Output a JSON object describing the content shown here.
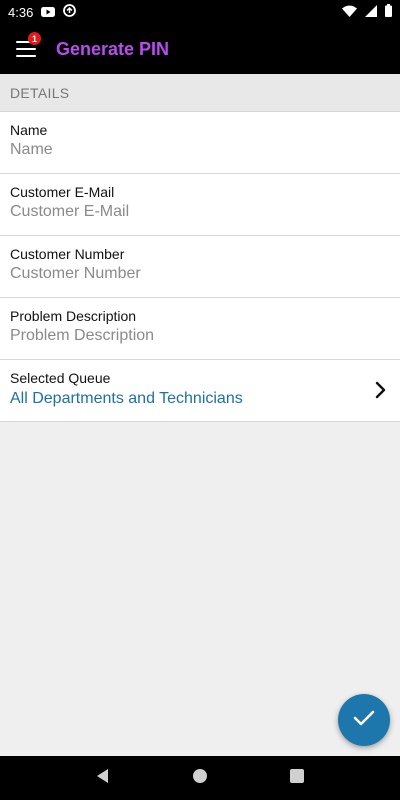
{
  "status_bar": {
    "time": "4:36",
    "icons": [
      "youtube-icon",
      "sync-icon",
      "wifi-icon",
      "signal-icon",
      "battery-icon"
    ]
  },
  "app_bar": {
    "title": "Generate PIN",
    "badge_count": "1",
    "title_color": "#b84cf0"
  },
  "section": {
    "header": "DETAILS"
  },
  "form": {
    "name": {
      "label": "Name",
      "placeholder": "Name"
    },
    "email": {
      "label": "Customer E-Mail",
      "placeholder": "Customer E-Mail"
    },
    "customer_number": {
      "label": "Customer Number",
      "placeholder": "Customer Number"
    },
    "problem": {
      "label": "Problem Description",
      "placeholder": "Problem Description"
    },
    "queue": {
      "label": "Selected Queue",
      "value": "All Departments and Technicians",
      "value_color": "#1f6fa8"
    }
  },
  "fab": {
    "icon": "check-icon",
    "color": "#1d76ac"
  },
  "nav": {
    "icons": [
      "back-icon",
      "home-icon",
      "recents-icon"
    ]
  }
}
